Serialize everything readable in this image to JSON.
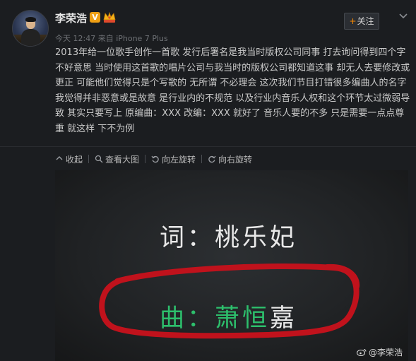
{
  "user": {
    "name": "李荣浩",
    "verified_badge": "V",
    "vip_icon": "vip-crown-icon"
  },
  "follow": {
    "label": "关注",
    "plus": "+"
  },
  "meta": {
    "time": "今天 12:47",
    "source": "来自 iPhone 7 Plus"
  },
  "post": {
    "text": "2013年给一位歌手创作一首歌 发行后署名是我当时版权公司同事 打去询问得到四个字 不好意思 当时使用这首歌的唱片公司与我当时的版权公司都知道这事 却无人去要修改或更正 可能他们觉得只是个写歌的 无所谓 不必理会 这次我们节目打错很多编曲人的名字 我觉得并非恶意或是故意 是行业内的不规范 以及行业内音乐人权和这个环节太过微弱导致 其实只要写上 原编曲：XXX 改编：XXX 就好了 音乐人要的不多 只是需要一点点尊重 就这样 下不为例"
  },
  "toolbar": {
    "collapse": "收起",
    "view_large": "查看大图",
    "rotate_left": "向左旋转",
    "rotate_right": "向右旋转"
  },
  "image": {
    "lyric_credit": "词：桃乐妃",
    "composer_prefix": "曲：萧恒",
    "composer_last": "嘉",
    "watermark": "@李荣浩"
  },
  "colors": {
    "background": "#1b1d20",
    "green_text": "#2dbf6c",
    "red_circle": "#c0121c",
    "accent_orange": "#ff8c00"
  }
}
